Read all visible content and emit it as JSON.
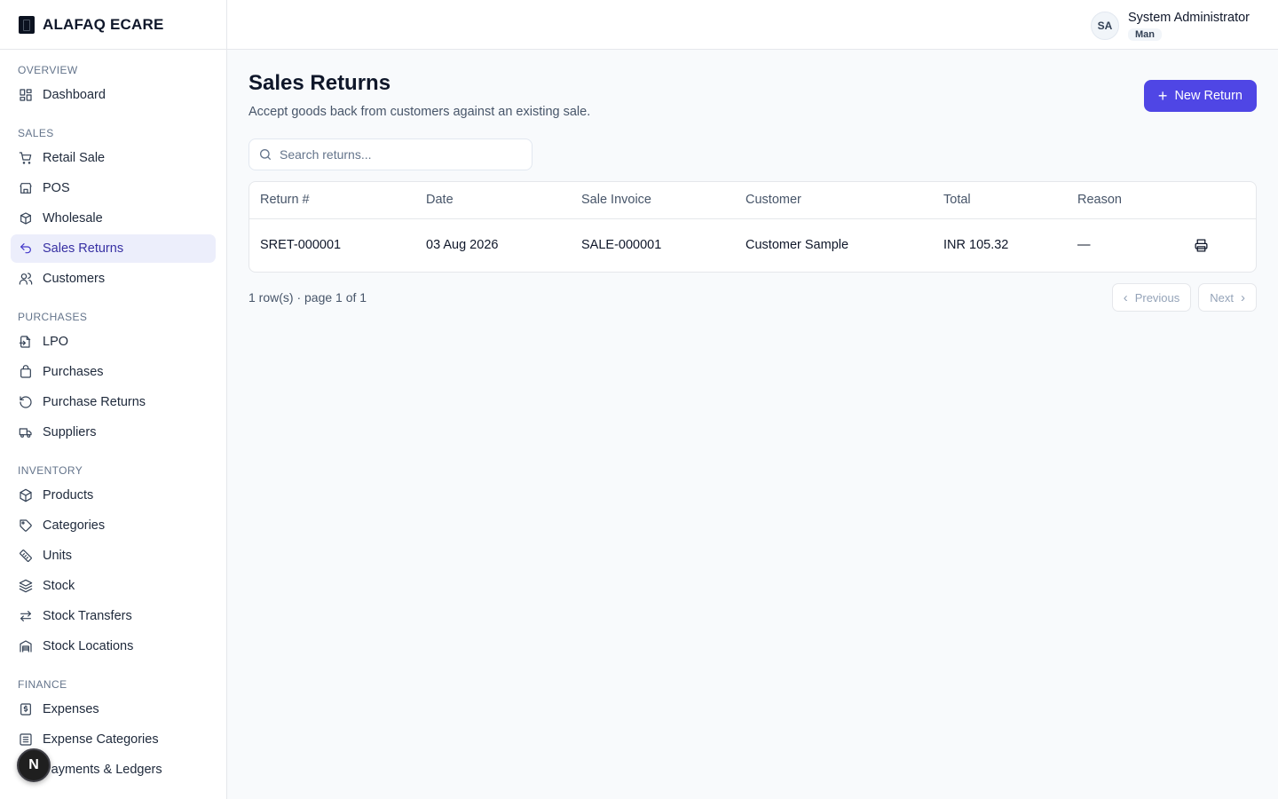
{
  "brand": {
    "name": "ALAFAQ ECARE"
  },
  "sidebar": {
    "sections": [
      {
        "label": "OVERVIEW",
        "items": [
          {
            "label": "Dashboard",
            "icon": "dashboard-icon"
          }
        ]
      },
      {
        "label": "SALES",
        "items": [
          {
            "label": "Retail Sale",
            "icon": "cart-icon"
          },
          {
            "label": "POS",
            "icon": "store-icon"
          },
          {
            "label": "Wholesale",
            "icon": "packages-icon"
          },
          {
            "label": "Sales Returns",
            "icon": "undo-icon",
            "active": true
          },
          {
            "label": "Customers",
            "icon": "users-icon"
          }
        ]
      },
      {
        "label": "PURCHASES",
        "items": [
          {
            "label": "LPO",
            "icon": "file-import-icon"
          },
          {
            "label": "Purchases",
            "icon": "shopping-bag-icon"
          },
          {
            "label": "Purchase Returns",
            "icon": "rotate-ccw-icon"
          },
          {
            "label": "Suppliers",
            "icon": "truck-icon"
          }
        ]
      },
      {
        "label": "INVENTORY",
        "items": [
          {
            "label": "Products",
            "icon": "box-icon"
          },
          {
            "label": "Categories",
            "icon": "tag-icon"
          },
          {
            "label": "Units",
            "icon": "ruler-icon"
          },
          {
            "label": "Stock",
            "icon": "layers-icon"
          },
          {
            "label": "Stock Transfers",
            "icon": "arrows-swap-icon"
          },
          {
            "label": "Stock Locations",
            "icon": "warehouse-icon"
          }
        ]
      },
      {
        "label": "FINANCE",
        "items": [
          {
            "label": "Expenses",
            "icon": "receipt-icon"
          },
          {
            "label": "Expense Categories",
            "icon": "list-icon"
          },
          {
            "label": "Payments & Ledgers",
            "icon": "wallet-icon"
          }
        ]
      }
    ]
  },
  "user": {
    "initials": "SA",
    "name": "System Administrator",
    "role": "Man"
  },
  "page": {
    "title": "Sales Returns",
    "subtitle": "Accept goods back from customers against an existing sale.",
    "new_button": "New Return"
  },
  "search": {
    "placeholder": "Search returns...",
    "value": ""
  },
  "table": {
    "columns": [
      "Return #",
      "Date",
      "Sale Invoice",
      "Customer",
      "Total",
      "Reason"
    ],
    "rows": [
      {
        "return_no": "SRET-000001",
        "date": "03 Aug 2026",
        "sale_invoice": "SALE-000001",
        "customer": "Customer Sample",
        "total": "INR 105.32",
        "reason": "—"
      }
    ]
  },
  "pagination": {
    "info": "1 row(s) · page 1 of 1",
    "previous": "Previous",
    "next": "Next"
  },
  "floating": {
    "label": "N"
  },
  "colors": {
    "accent": "#4f46e5",
    "active_bg": "#eceefb"
  }
}
